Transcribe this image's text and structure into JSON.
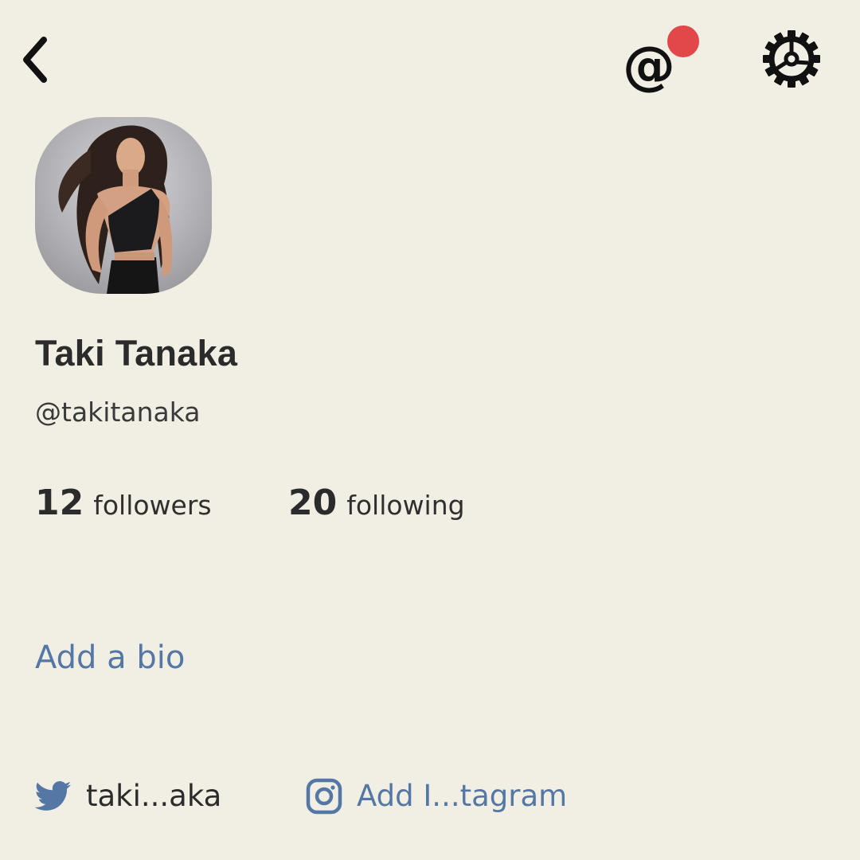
{
  "header": {
    "back_icon": "chevron-left-icon",
    "mention_icon": "at-sign-icon",
    "mention_glyph": "@",
    "notification_dot_color": "#e2474a",
    "settings_icon": "gear-icon"
  },
  "profile": {
    "name": "Taki Tanaka",
    "handle": "@takitanaka",
    "followers_count": "12",
    "followers_label": "followers",
    "following_count": "20",
    "following_label": "following",
    "add_bio_label": "Add a bio"
  },
  "social": {
    "twitter_icon": "twitter-bird-icon",
    "twitter_handle": "taki...aka",
    "instagram_icon": "instagram-icon",
    "instagram_label": "Add I...tagram"
  },
  "colors": {
    "background": "#f1efe4",
    "text": "#2b2b2b",
    "link": "#5577a6",
    "notification": "#e2474a"
  }
}
